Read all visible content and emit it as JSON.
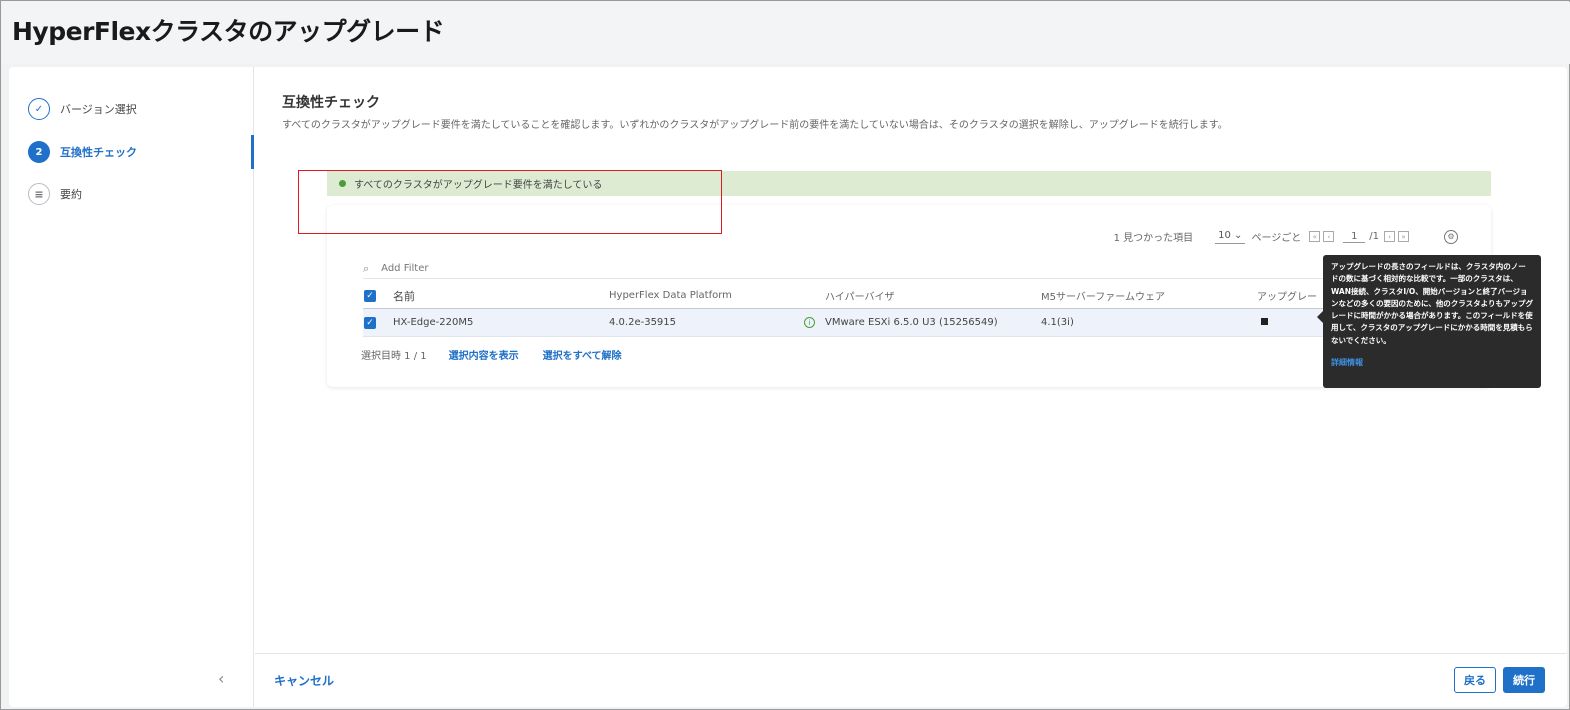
{
  "header": {
    "title": "HyperFlexクラスタのアップグレード"
  },
  "steps": [
    {
      "label": "バージョン選択",
      "marker": "✓",
      "icon": "check-icon"
    },
    {
      "label": "互換性チェック",
      "marker": "2"
    },
    {
      "label": "要約",
      "marker": "≡",
      "icon": "list-icon"
    }
  ],
  "main": {
    "title": "互換性チェック",
    "description": "すべてのクラスタがアップグレード要件を満たしていることを確認します。いずれかのクラスタがアップグレード前の要件を満たしていない場合は、そのクラスタの選択を解除し、アップグレードを続行します。",
    "banner": "すべてのクラスタがアップグレード要件を満たしている"
  },
  "table": {
    "found": "1 見つかった項目",
    "per_page": "10 ⌄",
    "per_page_label": "ページごと",
    "page": "1",
    "page_total": "/1",
    "filter_placeholder": "Add Filter",
    "columns": [
      "名前",
      "HyperFlex Data Platform",
      "ハイパーバイザ",
      "M5サーバーファームウェア",
      "アップグレー"
    ],
    "rows": [
      {
        "name": "HX-Edge-220M5",
        "hxdp": "4.0.2e-35915",
        "hypervisor": "VMware ESXi 6.5.0 U3 (15256549)",
        "firmware": "4.1(3i)"
      }
    ],
    "selected": "選択目時 1 / 1",
    "show_selection": "選択内容を表示",
    "clear_selection": "選択をすべて解除"
  },
  "tooltip": {
    "text": "アップグレードの長さのフィールドは、クラスタ内のノードの数に基づく相対的な比較です。一部のクラスタは、WAN接続、クラスタI/O、開始バージョンと終了バージョンなどの多くの要因のために、他のクラスタよりもアップグレードに時間がかかる場合があります。このフィールドを使用して、クラスタのアップグレードにかかる時間を見積もらないでください。",
    "link": "詳細情報"
  },
  "footer": {
    "cancel": "キャンセル",
    "back": "戻る",
    "next": "続行"
  },
  "colors": {
    "accent": "#1f70c8",
    "success_bg": "#dcebd2",
    "success_dot": "#4a9d3a",
    "highlight": "#e0181f"
  }
}
